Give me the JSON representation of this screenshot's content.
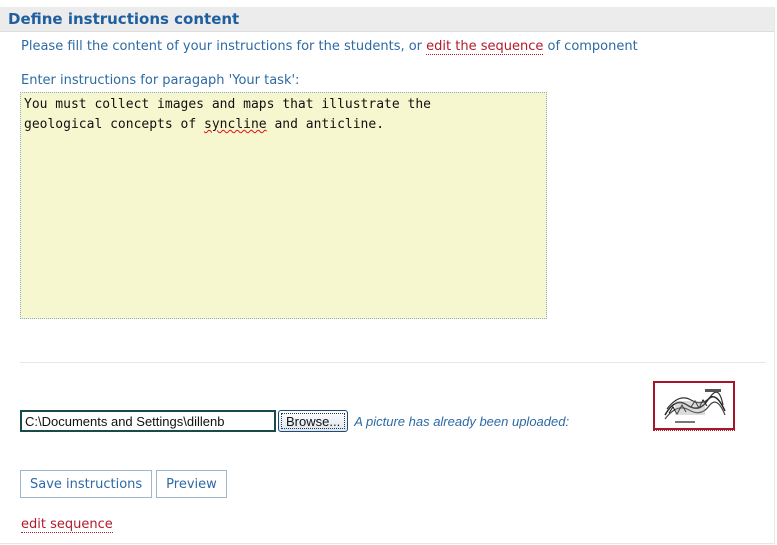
{
  "header": {
    "title": "Define instructions content"
  },
  "intro": {
    "text_before": "Please fill the content of your instructions for the students, or ",
    "link": "edit the sequence",
    "text_after": " of component"
  },
  "instructions": {
    "label": "Enter instructions for paragaph 'Your task':",
    "line1": "You must collect images and maps that illustrate the",
    "line2_before": "geological concepts of ",
    "line2_spell": "syncline",
    "line2_after": " and anticline."
  },
  "upload": {
    "file_value": "C:\\Documents and Settings\\dillenb",
    "browse_label": "Browse...",
    "uploaded_text": "A picture has already been uploaded:",
    "thumbnail_icon": "geology-sketch-thumbnail"
  },
  "actions": {
    "save_label": "Save instructions",
    "preview_label": "Preview"
  },
  "footer": {
    "edit_sequence_label": "edit sequence"
  },
  "colors": {
    "header_text": "#1f5fa0",
    "body_text": "#2d6aa5",
    "link_red": "#b5192b",
    "textarea_bg": "#f7f7cf"
  }
}
